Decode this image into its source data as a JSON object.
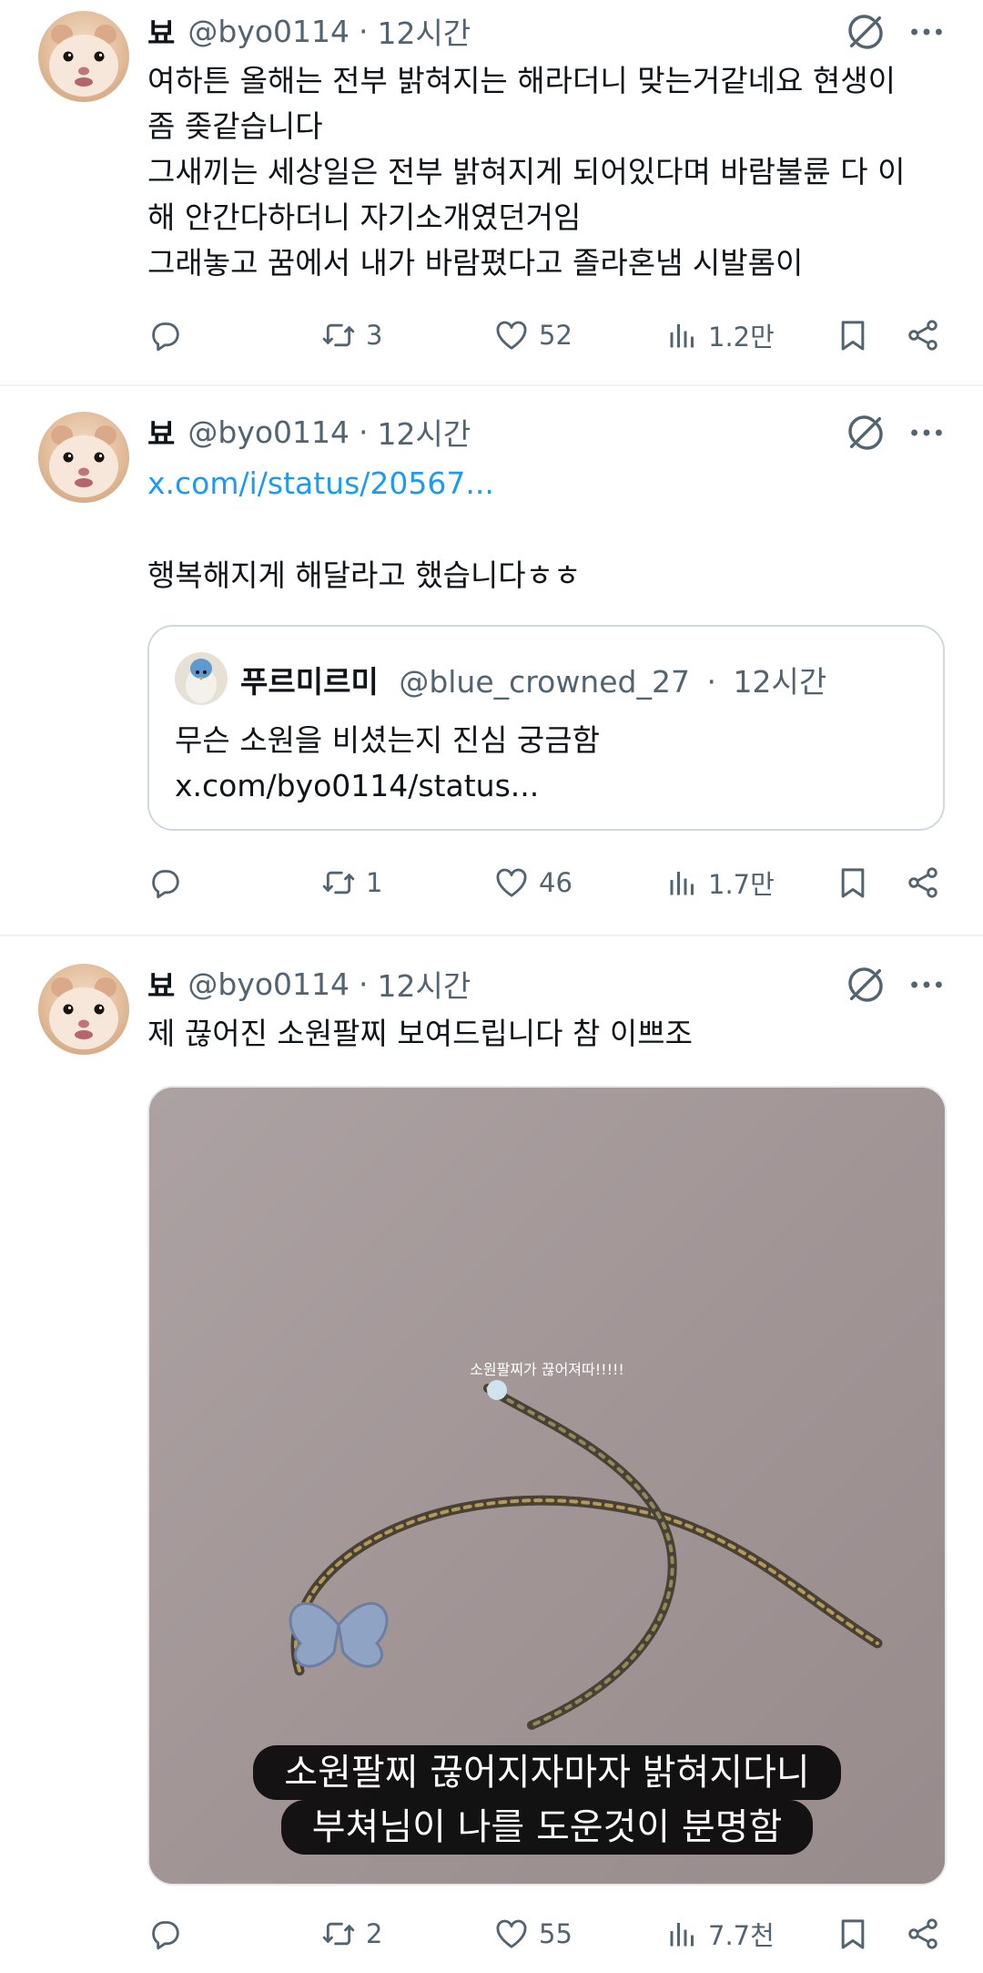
{
  "tweets": [
    {
      "name": "뵤",
      "handle": "@byo0114",
      "dot": "·",
      "time": "12시간",
      "text": "여하튼 올해는 전부 밝혀지는 해라더니 맞는거같네요 현생이\n좀 좆같습니다\n그새끼는 세상일은 전부 밝혀지게 되어있다며 바람불륜 다 이\n해 안간다하더니 자기소개였던거임\n그래놓고 꿈에서 내가 바람폈다고 졸라혼냄 시발롬이",
      "replies": "",
      "retweets": "3",
      "likes": "52",
      "views": "1.2만"
    },
    {
      "name": "뵤",
      "handle": "@byo0114",
      "dot": "·",
      "time": "12시간",
      "link": "x.com/i/status/20567...",
      "text": "행복해지게 해달라고 했습니다ㅎㅎ",
      "quote": {
        "name": "푸르미르미",
        "handle": "@blue_crowned_27",
        "dot": "·",
        "time": "12시간",
        "text": "무슨 소원을 비셨는지 진심 궁금함\nx.com/byo0114/status..."
      },
      "replies": "",
      "retweets": "1",
      "likes": "46",
      "views": "1.7만"
    },
    {
      "name": "뵤",
      "handle": "@byo0114",
      "dot": "·",
      "time": "12시간",
      "text": "제 끊어진 소원팔찌 보여드립니다 참 이쁘조",
      "media": {
        "caption": "소원팔찌가 끊어져따!!!!!",
        "subtitle_line1": "소원팔찌 끊어지자마자 밝혀지다니",
        "subtitle_line2": "부쳐님이 나를 도운것이 분명함"
      },
      "replies": "",
      "retweets": "2",
      "likes": "55",
      "views": "7.7천"
    }
  ],
  "icons": {
    "reply": "reply-icon",
    "retweet": "retweet-icon",
    "like": "heart-icon",
    "views": "views-icon",
    "bookmark": "bookmark-icon",
    "share": "share-icon",
    "grok": "grok-icon",
    "more": "more-icon"
  },
  "colors": {
    "text": "#0f1419",
    "secondary": "#536471",
    "link": "#1d9bf0",
    "divider": "#eff3f4"
  }
}
